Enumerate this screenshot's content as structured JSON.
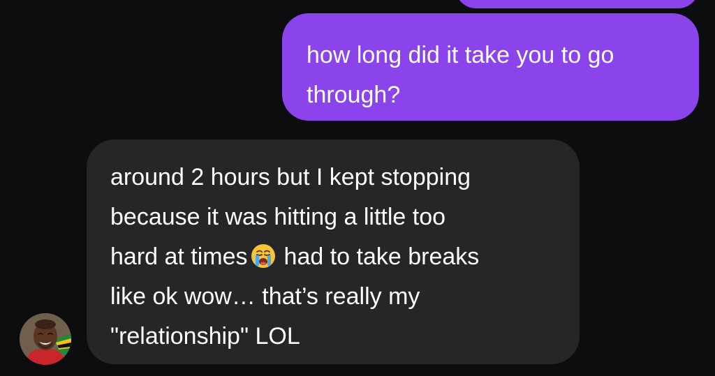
{
  "conversation": {
    "sent_message": {
      "lines": [
        "how long did it take you to go",
        "through?"
      ]
    },
    "received_message": {
      "line1": "around 2 hours but I kept stopping",
      "line2": "because it was hitting a little too",
      "line3_before_emoji": "hard at times",
      "line3_after_emoji": "had to take breaks",
      "line4": "like ok wow… that’s really my",
      "line5": "\"relationship\" LOL",
      "emoji_icon": "loudly-crying-face-icon"
    },
    "avatar_icon": "contact-avatar"
  },
  "colors": {
    "background": "#0c0d0f",
    "sent_bubble": "#8b44eb",
    "received_bubble": "#242628",
    "text": "#ffffff"
  }
}
